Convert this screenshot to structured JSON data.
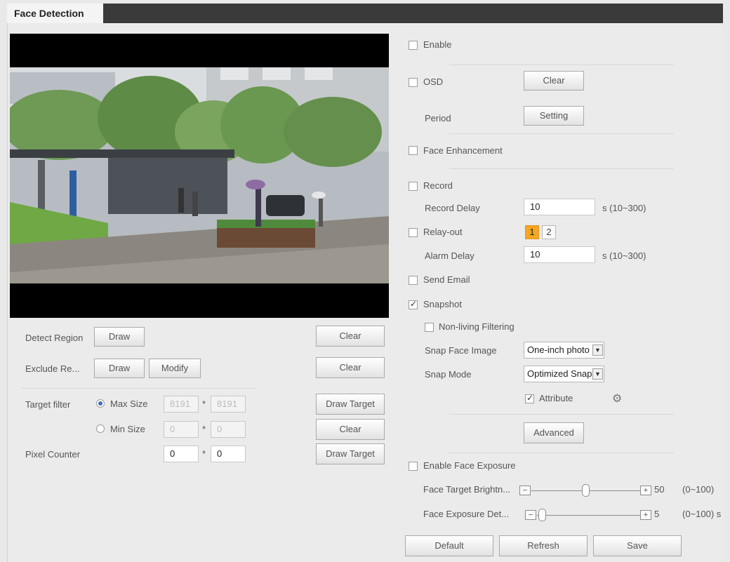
{
  "window": {
    "tab_title": "Face Detection"
  },
  "left": {
    "detect_region_label": "Detect Region",
    "detect_region_draw": "Draw",
    "detect_region_clear": "Clear",
    "exclude_region_label": "Exclude Re...",
    "exclude_region_draw": "Draw",
    "exclude_region_modify": "Modify",
    "exclude_region_clear": "Clear",
    "target_filter_label": "Target filter",
    "max_size_label": "Max Size",
    "max_size_w": "8191",
    "max_size_h": "8191",
    "min_size_label": "Min Size",
    "min_size_w": "0",
    "min_size_h": "0",
    "times_sign": "*",
    "draw_target_1": "Draw Target",
    "clear_target": "Clear",
    "pixel_counter_label": "Pixel Counter",
    "pixel_w": "0",
    "pixel_h": "0",
    "draw_target_2": "Draw Target"
  },
  "right": {
    "enable_label": "Enable",
    "osd_label": "OSD",
    "osd_clear": "Clear",
    "period_label": "Period",
    "period_setting": "Setting",
    "face_enhancement_label": "Face Enhancement",
    "record_label": "Record",
    "record_delay_label": "Record Delay",
    "record_delay_value": "10",
    "record_delay_unit": "s (10~300)",
    "relay_out_label": "Relay-out",
    "relay_1": "1",
    "relay_2": "2",
    "alarm_delay_label": "Alarm Delay",
    "alarm_delay_value": "10",
    "alarm_delay_unit": "s (10~300)",
    "send_email_label": "Send Email",
    "snapshot_label": "Snapshot",
    "non_living_label": "Non-living Filtering",
    "snap_face_image_label": "Snap Face Image",
    "snap_face_image_value": "One-inch photo",
    "snap_mode_label": "Snap Mode",
    "snap_mode_value": "Optimized Snap",
    "attribute_label": "Attribute",
    "advanced_button": "Advanced",
    "enable_face_exposure_label": "Enable Face Exposure",
    "face_target_brightness_label": "Face Target Brightn...",
    "face_target_brightness_value": "50",
    "face_target_brightness_range": "(0~100)",
    "face_exposure_detect_label": "Face Exposure Det...",
    "face_exposure_detect_value": "5",
    "face_exposure_detect_range": "(0~100) s"
  },
  "footer": {
    "default_button": "Default",
    "refresh_button": "Refresh",
    "save_button": "Save"
  },
  "state": {
    "enable": false,
    "osd": false,
    "face_enhancement": false,
    "record": false,
    "relay_out": false,
    "send_email": false,
    "snapshot": true,
    "non_living": false,
    "attribute": true,
    "enable_face_exposure": false,
    "target_filter": "Max Size",
    "relay_active": "1",
    "face_target_brightness_level": 50,
    "face_exposure_detect_level": 5
  },
  "icons": {
    "dropdown": "chevron-down-icon",
    "gear": "gear-icon",
    "minus": "minus-icon",
    "plus": "plus-icon"
  }
}
